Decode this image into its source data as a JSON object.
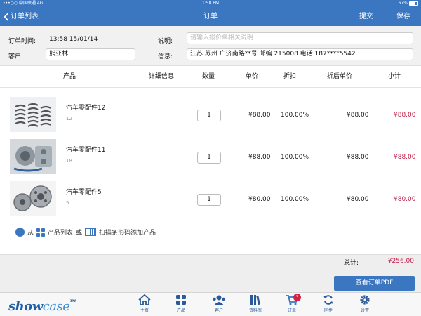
{
  "statusbar": {
    "carrier": "•••○○ 中国联通  4G",
    "time": "1:58 PM",
    "battery": "67%",
    "battery_level": 0.67
  },
  "nav": {
    "back_label": "订单列表",
    "title": "订单",
    "submit_label": "提交",
    "save_label": "保存"
  },
  "order_info": {
    "time_label": "订单时间:",
    "time_value": "13:58 15/01/14",
    "note_label": "说明:",
    "note_placeholder": "请输入报价单相关说明",
    "customer_label": "客户:",
    "customer_value": "熊亚林",
    "info_label": "信息:",
    "info_value": "江苏 苏州 广济南路**号 邮编 215008  电话 187****5542"
  },
  "table": {
    "headers": {
      "product": "产品",
      "detail": "详细信息",
      "qty": "数量",
      "price": "单价",
      "discount": "折扣",
      "discounted_price": "折后单价",
      "subtotal": "小计"
    },
    "rows": [
      {
        "name": "汽车零配件12",
        "code": "12",
        "qty": "1",
        "price": "¥88.00",
        "discount": "100.00%",
        "discounted_price": "¥88.00",
        "subtotal": "¥88.00",
        "image": "springs"
      },
      {
        "name": "汽车零配件11",
        "code": "18",
        "qty": "1",
        "price": "¥88.00",
        "discount": "100.00%",
        "discounted_price": "¥88.00",
        "subtotal": "¥88.00",
        "image": "engine-parts"
      },
      {
        "name": "汽车零配件5",
        "code": "5",
        "qty": "1",
        "price": "¥80.00",
        "discount": "100.00%",
        "discounted_price": "¥80.00",
        "subtotal": "¥80.00",
        "image": "pulleys"
      }
    ]
  },
  "add_product": {
    "from": "从",
    "product_list": "产品列表",
    "or": "或",
    "scan": "扫描条形码添加产品"
  },
  "total": {
    "label": "总计:",
    "value": "¥256.00",
    "pdf_button": "查看订单PDF"
  },
  "tabbar": {
    "logo_show": "show",
    "logo_case": "case",
    "logo_tm": "TM",
    "tabs": [
      {
        "label": "主页",
        "icon": "home-icon"
      },
      {
        "label": "产品",
        "icon": "grid-icon"
      },
      {
        "label": "客户",
        "icon": "customers-icon"
      },
      {
        "label": "资料库",
        "icon": "library-icon"
      },
      {
        "label": "订单",
        "icon": "cart-icon",
        "badge": "3",
        "active": true
      },
      {
        "label": "同步",
        "icon": "sync-icon"
      },
      {
        "label": "设置",
        "icon": "gear-icon"
      }
    ]
  },
  "colors": {
    "primary": "#3b76c0",
    "accent_red": "#c02048",
    "badge_red": "#d2204a"
  }
}
